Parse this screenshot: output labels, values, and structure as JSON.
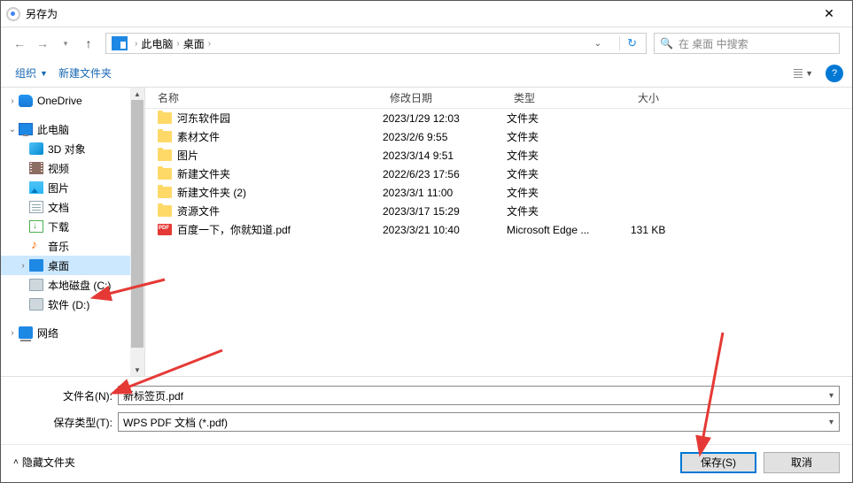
{
  "window": {
    "title": "另存为"
  },
  "breadcrumb": {
    "root": "此电脑",
    "current": "桌面"
  },
  "search": {
    "placeholder": "在 桌面 中搜索"
  },
  "toolbar": {
    "organize": "组织",
    "new_folder": "新建文件夹"
  },
  "sidebar": {
    "onedrive": "OneDrive",
    "this_pc": "此电脑",
    "items": [
      {
        "label": "3D 对象",
        "icon": "ic-3d"
      },
      {
        "label": "视频",
        "icon": "ic-video"
      },
      {
        "label": "图片",
        "icon": "ic-pic"
      },
      {
        "label": "文档",
        "icon": "ic-doc"
      },
      {
        "label": "下载",
        "icon": "ic-dl"
      },
      {
        "label": "音乐",
        "icon": "ic-music"
      },
      {
        "label": "桌面",
        "icon": "ic-desktop",
        "selected": true
      },
      {
        "label": "本地磁盘 (C:)",
        "icon": "ic-disk"
      },
      {
        "label": "软件 (D:)",
        "icon": "ic-disk"
      }
    ],
    "network": "网络"
  },
  "columns": {
    "name": "名称",
    "date": "修改日期",
    "type": "类型",
    "size": "大小"
  },
  "files": [
    {
      "name": "河东软件园",
      "date": "2023/1/29 12:03",
      "type": "文件夹",
      "size": "",
      "icon": "ic-folder"
    },
    {
      "name": "素材文件",
      "date": "2023/2/6 9:55",
      "type": "文件夹",
      "size": "",
      "icon": "ic-folder"
    },
    {
      "name": "图片",
      "date": "2023/3/14 9:51",
      "type": "文件夹",
      "size": "",
      "icon": "ic-folder"
    },
    {
      "name": "新建文件夹",
      "date": "2022/6/23 17:56",
      "type": "文件夹",
      "size": "",
      "icon": "ic-folder"
    },
    {
      "name": "新建文件夹 (2)",
      "date": "2023/3/1 11:00",
      "type": "文件夹",
      "size": "",
      "icon": "ic-folder"
    },
    {
      "name": "资源文件",
      "date": "2023/3/17 15:29",
      "type": "文件夹",
      "size": "",
      "icon": "ic-folder"
    },
    {
      "name": "百度一下，你就知道.pdf",
      "date": "2023/3/21 10:40",
      "type": "Microsoft Edge ...",
      "size": "131 KB",
      "icon": "ic-pdf"
    }
  ],
  "fields": {
    "filename_label": "文件名(N):",
    "filename_value": "新标签页.pdf",
    "filetype_label": "保存类型(T):",
    "filetype_value": "WPS PDF 文档 (*.pdf)"
  },
  "footer": {
    "hide_folders": "隐藏文件夹",
    "save": "保存(S)",
    "cancel": "取消"
  }
}
